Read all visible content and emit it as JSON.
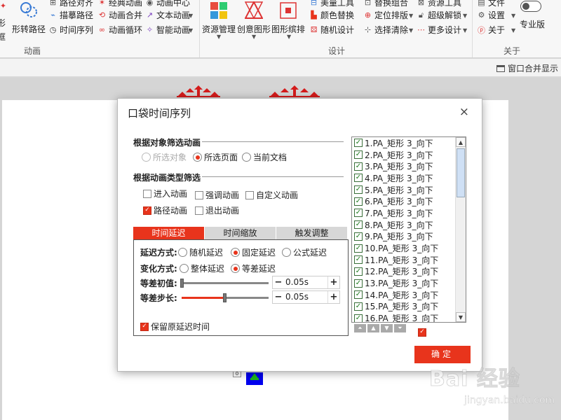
{
  "ribbon": {
    "left_items": [
      "形",
      "框"
    ],
    "anim_big": "形转路径",
    "anim_rows": [
      [
        "路径对齐",
        "经典动画",
        "动画中心"
      ],
      [
        "描摹路径",
        "动画合并",
        "文本动画"
      ],
      [
        "时间序列",
        "动画循环",
        "智能动画"
      ]
    ],
    "anim_group": "动画",
    "design_big": [
      "资源管理",
      "创意图形",
      "图形缤排"
    ],
    "design_rows": [
      [
        "美量工具",
        "替换组合",
        "资源工具"
      ],
      [
        "颜色替换",
        "定位排版",
        "超级解锁"
      ],
      [
        "随机设计",
        "选择清除",
        "更多设计"
      ]
    ],
    "design_group": "设计",
    "about_items": [
      "文件",
      "设置",
      "关于"
    ],
    "about_group": "关于",
    "pro_label": "专业版"
  },
  "statusbar": {
    "window_merge": "窗口合并显示"
  },
  "slide": {
    "small_box_text": "0"
  },
  "dialog": {
    "title": "口袋时间序列",
    "close": "×",
    "filter_by_object": {
      "title": "根据对象筛选动画",
      "options": [
        "所选对象",
        "所选页面",
        "当前文档"
      ],
      "selected": "所选页面"
    },
    "filter_by_type": {
      "title": "根据动画类型筛选",
      "options": [
        "进入动画",
        "强调动画",
        "自定义动画",
        "路径动画",
        "退出动画"
      ],
      "checked": [
        "路径动画"
      ]
    },
    "tabs": [
      "时间延迟",
      "时间缩放",
      "触发调整"
    ],
    "active_tab": "时间延迟",
    "delay_mode": {
      "label": "延迟方式:",
      "options": [
        "随机延迟",
        "固定延迟",
        "公式延迟"
      ],
      "selected": "固定延迟"
    },
    "change_mode": {
      "label": "变化方式:",
      "options": [
        "整体延迟",
        "等差延迟"
      ],
      "selected": "等差延迟"
    },
    "initial": {
      "label": "等差初值:",
      "value": "0.05s",
      "slider_fraction": 0.0
    },
    "step": {
      "label": "等差步长:",
      "value": "0.05s",
      "slider_fraction": 0.49
    },
    "keep_original": "保留原延迟时间",
    "list_items": [
      "1.PA_矩形 3_向下",
      "2.PA_矩形 3_向下",
      "3.PA_矩形 3_向下",
      "4.PA_矩形 3_向下",
      "5.PA_矩形 3_向下",
      "6.PA_矩形 3_向下",
      "7.PA_矩形 3_向下",
      "8.PA_矩形 3_向下",
      "9.PA_矩形 3_向下",
      "10.PA_矩形 3_向下",
      "11.PA_矩形 3_向下",
      "12.PA_矩形 3_向下",
      "13.PA_矩形 3_向下",
      "14.PA_矩形 3_向下",
      "15.PA_矩形 3_向下",
      "16.PA_矩形 3_向下"
    ],
    "ok_label": "确定"
  },
  "watermark": {
    "logo": "Bai 经验",
    "url": "jingyan.baidu.com"
  },
  "colors": {
    "accent": "#e8341c",
    "check_green": "#1d7a1d",
    "shape_blue": "#0000ee"
  }
}
